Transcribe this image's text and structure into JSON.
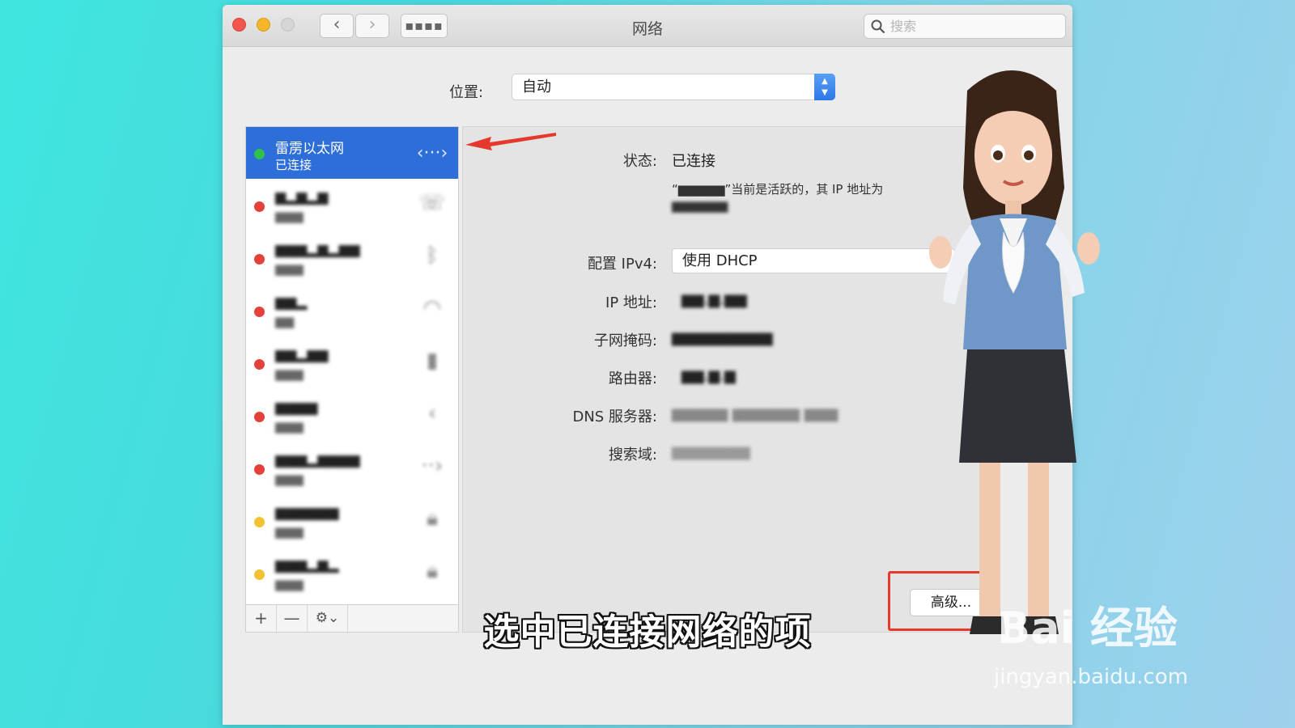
{
  "window": {
    "title": "网络",
    "search_placeholder": "搜索"
  },
  "location": {
    "label": "位置:",
    "value": "自动"
  },
  "services": [
    {
      "name": "雷雳以太网",
      "status": "已连接",
      "dot_color": "#2fc24a",
      "icon": "ethernet-icon",
      "selected": true
    },
    {
      "name": "▆▂▆▂▆",
      "status": "▆▆▆",
      "dot_color": "#e5413b",
      "icon": "phone-icon",
      "selected": false
    },
    {
      "name": "▆▆▆▂▆▂▆▆",
      "status": "▆▆▆",
      "dot_color": "#e5413b",
      "icon": "bluetooth-icon",
      "selected": false
    },
    {
      "name": "▆▆▂",
      "status": "▆▆",
      "dot_color": "#e5413b",
      "icon": "wifi-icon",
      "selected": false
    },
    {
      "name": "▆▆▂▆▆",
      "status": "▆▆▆",
      "dot_color": "#e5413b",
      "icon": "iphone-icon",
      "selected": false
    },
    {
      "name": "▆▆▆▆",
      "status": "▆▆▆",
      "dot_color": "#e5413b",
      "icon": "bluetooth-pan-icon",
      "selected": false
    },
    {
      "name": "▆▆▆▂▆▆▆▆",
      "status": "▆▆▆",
      "dot_color": "#e5413b",
      "icon": "bridge-icon",
      "selected": false
    },
    {
      "name": "▆▆▆▆▆▆",
      "status": "▆▆▆",
      "dot_color": "#f3c232",
      "icon": "vpn-lock-icon",
      "selected": false
    },
    {
      "name": "▆▆▆▂▆▂",
      "status": "▆▆▆",
      "dot_color": "#f3c232",
      "icon": "vpn-lock-icon",
      "selected": false
    }
  ],
  "toolbar": {
    "add": "+",
    "remove": "—",
    "gear": "⚙︎⌄"
  },
  "details": {
    "status_label": "状态:",
    "status_value": "已连接",
    "status_note_line1": "“▆▆▆▆▆”当前是活跃的，其 IP 地址为",
    "status_note_line2": "▆▆▆▆▆▆",
    "ipv4_label": "配置 IPv4:",
    "ipv4_value": "使用 DHCP",
    "ip_label": "IP 地址:",
    "ip_value": "▆▆.▆.▆▆",
    "subnet_label": "子网掩码:",
    "subnet_value": "▆▆▆▆▆▆▆▆▆",
    "router_label": "路由器:",
    "router_value": "▆▆.▆.▆",
    "dns_label": "DNS 服务器:",
    "dns_value": "▆▆▆▆▆   ▆▆▆▆▆▆   ▆▆▆",
    "search_domain_label": "搜索域:",
    "search_domain_value": "▆▆▆▆▆▆▆",
    "advanced_button": "高级..."
  },
  "caption": "选中已连接网络的项",
  "watermark": {
    "main": "Bai 经验",
    "sub": "jingyan.baidu.com"
  },
  "colors": {
    "selection": "#2e6ed8",
    "highlight": "#e5392d"
  }
}
